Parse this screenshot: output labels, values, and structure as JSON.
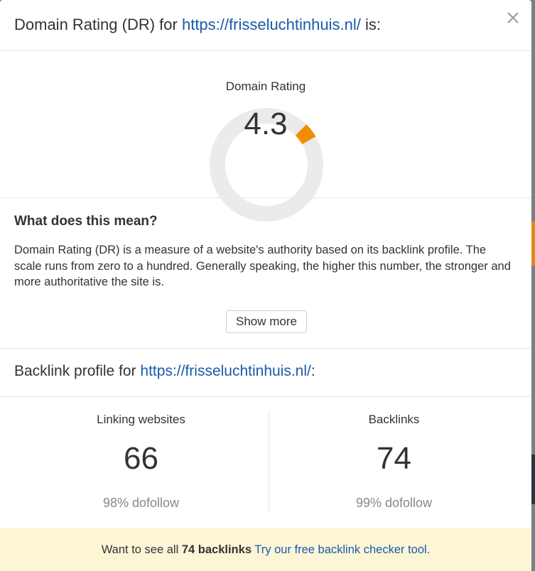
{
  "header": {
    "prefix": "Domain Rating (DR) for",
    "url": "https://frisseluchtinhuis.nl/",
    "suffix": "is:",
    "close_icon": "close-icon"
  },
  "gauge": {
    "label": "Domain Rating",
    "value": "4.3",
    "value_number": 4.3,
    "max": 100,
    "track_color": "#ebebeb",
    "fill_color": "#f28c00"
  },
  "meaning": {
    "title": "What does this mean?",
    "text": "Domain Rating (DR) is a measure of a website's authority based on its backlink profile. The scale runs from zero to a hundred. Generally speaking, the higher this number, the stronger and more authoritative the site is.",
    "button_label": "Show more"
  },
  "backlinks": {
    "prefix": "Backlink profile for",
    "url": "https://frisseluchtinhuis.nl/",
    "suffix": ":",
    "stats": [
      {
        "label": "Linking websites",
        "value": "66",
        "sub": "98% dofollow"
      },
      {
        "label": "Backlinks",
        "value": "74",
        "sub": "99% dofollow"
      }
    ]
  },
  "footer": {
    "prefix": "Want to see all",
    "bold": "74 backlinks",
    "cta": "Try our free backlink checker tool."
  },
  "colors": {
    "link": "#1a5aa8",
    "footer_bg": "#fcf6d7"
  }
}
